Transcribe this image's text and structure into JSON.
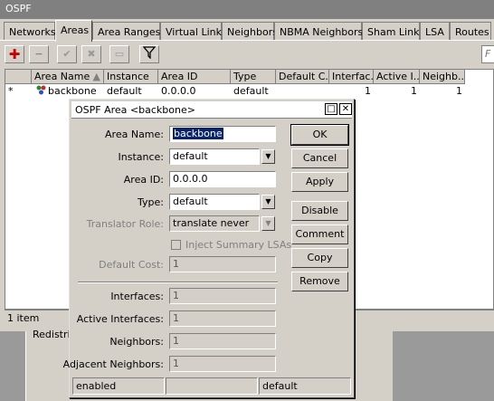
{
  "window": {
    "title": "OSPF"
  },
  "tabs": [
    "Networks",
    "Areas",
    "Area Ranges",
    "Virtual Links",
    "Neighbors",
    "NBMA Neighbors",
    "Sham Links",
    "LSA",
    "Routes"
  ],
  "find_placeholder": "F",
  "grid": {
    "headers": [
      "Area Name",
      "Instance",
      "Area ID",
      "Type",
      "Default C...",
      "Interfac...",
      "Active I...",
      "Neighb..."
    ],
    "row": {
      "marker": "*",
      "area_name": "backbone",
      "instance": "default",
      "area_id": "0.0.0.0",
      "type": "default",
      "default_cost": "",
      "interfaces": "1",
      "active_interfaces": "1",
      "neighbors": "1"
    }
  },
  "status": {
    "count": "1 item"
  },
  "behind": {
    "text": "Redistrib"
  },
  "dialog": {
    "title": "OSPF Area <backbone>",
    "fields": {
      "area_name_label": "Area Name:",
      "area_name": "backbone",
      "instance_label": "Instance:",
      "instance": "default",
      "area_id_label": "Area ID:",
      "area_id": "0.0.0.0",
      "type_label": "Type:",
      "type": "default",
      "translator_role_label": "Translator Role:",
      "translator_role": "translate never",
      "inject_label": "Inject Summary LSAs",
      "default_cost_label": "Default Cost:",
      "default_cost": "1",
      "interfaces_label": "Interfaces:",
      "interfaces": "1",
      "active_interfaces_label": "Active Interfaces:",
      "active_interfaces": "1",
      "neighbors_label": "Neighbors:",
      "neighbors": "1",
      "adjacent_neighbors_label": "Adjacent Neighbors:",
      "adjacent_neighbors": "1"
    },
    "buttons": [
      "OK",
      "Cancel",
      "Apply",
      "Disable",
      "Comment",
      "Copy",
      "Remove"
    ],
    "status": {
      "left": "enabled",
      "middle": "",
      "right": "default"
    }
  },
  "colors": {
    "title_bar": "#808080",
    "window_bg": "#d4d0c8",
    "selection": "#0a246a",
    "add_icon": "#cc0000"
  }
}
